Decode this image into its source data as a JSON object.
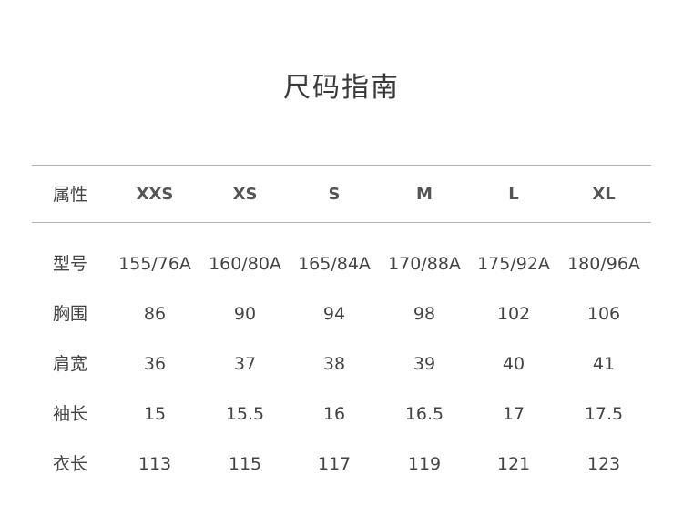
{
  "title": "尺码指南",
  "table": {
    "header": {
      "label": "属性",
      "sizes": [
        "XXS",
        "XS",
        "S",
        "M",
        "L",
        "XL"
      ]
    },
    "rows": [
      {
        "label": "型号",
        "values": [
          "155/76A",
          "160/80A",
          "165/84A",
          "170/88A",
          "175/92A",
          "180/96A"
        ]
      },
      {
        "label": "胸围",
        "values": [
          "86",
          "90",
          "94",
          "98",
          "102",
          "106"
        ]
      },
      {
        "label": "肩宽",
        "values": [
          "36",
          "37",
          "38",
          "39",
          "40",
          "41"
        ]
      },
      {
        "label": "袖长",
        "values": [
          "15",
          "15.5",
          "16",
          "16.5",
          "17",
          "17.5"
        ]
      },
      {
        "label": "衣长",
        "values": [
          "113",
          "115",
          "117",
          "119",
          "121",
          "123"
        ]
      }
    ]
  }
}
